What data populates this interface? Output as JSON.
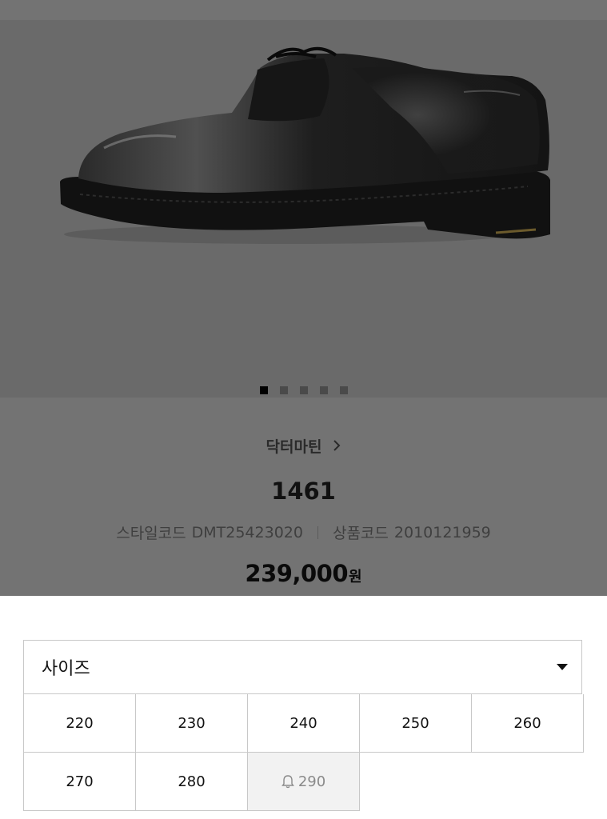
{
  "product": {
    "brand": "닥터마틴",
    "name": "1461",
    "style_code_label": "스타일코드",
    "style_code": "DMT25423020",
    "product_code_label": "상품코드",
    "product_code": "2010121959",
    "price": "239,000",
    "currency": "원"
  },
  "gallery": {
    "image_alt": "Black leather 3-eye shoe",
    "total_slides": 5,
    "active_slide": 1
  },
  "size_selector": {
    "label": "사이즈",
    "sizes": [
      {
        "value": "220",
        "sold_out": false
      },
      {
        "value": "230",
        "sold_out": false
      },
      {
        "value": "240",
        "sold_out": false
      },
      {
        "value": "250",
        "sold_out": false
      },
      {
        "value": "260",
        "sold_out": false
      },
      {
        "value": "270",
        "sold_out": false
      },
      {
        "value": "280",
        "sold_out": false
      },
      {
        "value": "290",
        "sold_out": true
      }
    ]
  },
  "icons": {
    "brand_arrow": "chevron-right-icon",
    "dropdown": "caret-down-icon",
    "restock_alert": "bell-icon"
  }
}
